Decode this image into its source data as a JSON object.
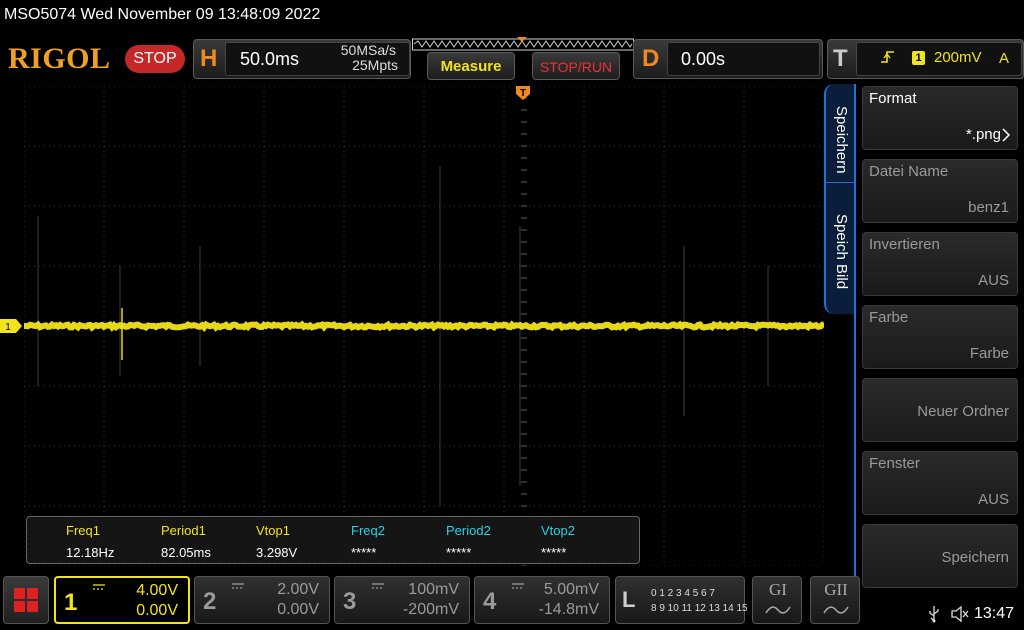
{
  "title_bar": {
    "text": "MSO5074  Wed November 09 13:48:09 2022"
  },
  "brand": {
    "logo": "RIGOL"
  },
  "run_state": {
    "label": "STOP"
  },
  "horizontal": {
    "letter": "H",
    "timebase": "50.0ms",
    "sample_rate": "50MSa/s",
    "memory_depth": "25Mpts"
  },
  "buttons": {
    "measure": "Measure",
    "stop_run": "STOP/RUN"
  },
  "delay": {
    "letter": "D",
    "value": "0.00s"
  },
  "trigger": {
    "letter": "T",
    "edge_icon": "rising-edge-icon",
    "channel": "1",
    "level": "200mV",
    "mode": "A"
  },
  "waveform": {
    "channel_marker": "1",
    "color": "#f2e41a"
  },
  "measurements": [
    {
      "label": "Freq1",
      "value": "12.18Hz",
      "color": "#f2e41a"
    },
    {
      "label": "Period1",
      "value": "82.05ms",
      "color": "#f2e41a"
    },
    {
      "label": "Vtop1",
      "value": "3.298V",
      "color": "#f2e41a"
    },
    {
      "label": "Freq2",
      "value": "*****",
      "color": "#27d3e6"
    },
    {
      "label": "Period2",
      "value": "*****",
      "color": "#27d3e6"
    },
    {
      "label": "Vtop2",
      "value": "*****",
      "color": "#27d3e6"
    }
  ],
  "menu": {
    "tabs": [
      "Speichern",
      "Speich Bild"
    ],
    "items": [
      {
        "title": "Format",
        "value": ".png"
      },
      {
        "title": "Datei Name",
        "value": "benz1"
      },
      {
        "title": "Invertieren",
        "value": "AUS"
      },
      {
        "title": "Farbe",
        "value": "Farbe"
      },
      {
        "title": "",
        "value": "Neuer Ordner"
      },
      {
        "title": "Fenster",
        "value": "AUS"
      },
      {
        "title": "",
        "value": "Speichern"
      }
    ]
  },
  "channels": [
    {
      "num": "1",
      "scale": "4.00V",
      "offset": "0.00V",
      "color": "#f2e41a",
      "active": true
    },
    {
      "num": "2",
      "scale": "2.00V",
      "offset": "0.00V",
      "color": "#9a9a9a",
      "active": false
    },
    {
      "num": "3",
      "scale": "100mV",
      "offset": "-200mV",
      "color": "#9a9a9a",
      "active": false
    },
    {
      "num": "4",
      "scale": "5.00mV",
      "offset": "-14.8mV",
      "color": "#9a9a9a",
      "active": false
    }
  ],
  "logic_analyzer": {
    "letter": "L",
    "row1": "0 1 2 3   4 5 6 7",
    "row2": "8 9 10 11  12 13 14 15"
  },
  "decoders": [
    {
      "label": "GI"
    },
    {
      "label": "GII"
    }
  ],
  "status": {
    "clock": "13:47"
  }
}
